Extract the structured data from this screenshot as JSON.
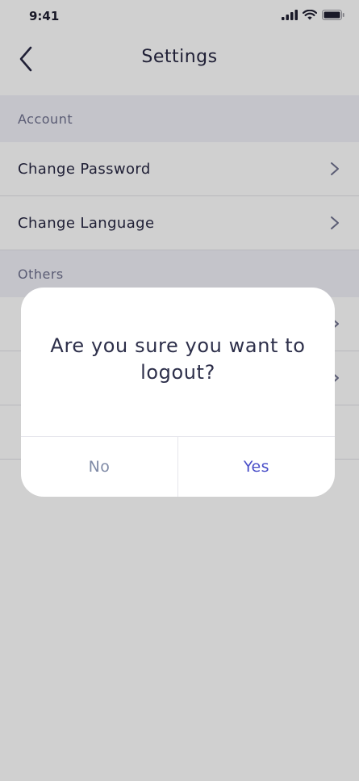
{
  "status_bar": {
    "time": "9:41"
  },
  "header": {
    "title": "Settings"
  },
  "sections": [
    {
      "title": "Account",
      "items": [
        {
          "label": "Change Password"
        },
        {
          "label": "Change Language"
        }
      ]
    },
    {
      "title": "Others"
    }
  ],
  "dialog": {
    "message": "Are you sure you want to logout?",
    "no_label": "No",
    "yes_label": "Yes"
  },
  "colors": {
    "accent": "#4a4fc8",
    "text_dark": "#23233f",
    "section_bg": "#f0f0f8",
    "overlay": "rgba(20,20,20,0.2)"
  }
}
